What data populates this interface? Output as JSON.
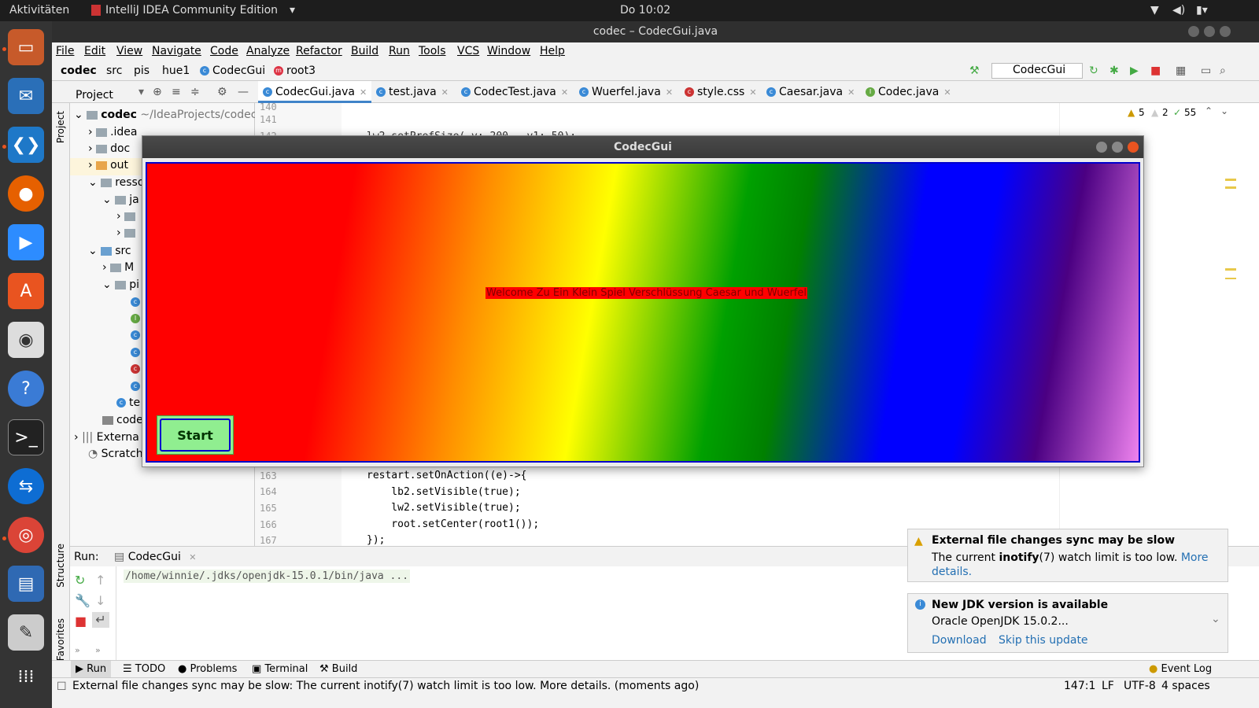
{
  "system": {
    "activities": "Aktivitäten",
    "app_name": "IntelliJ IDEA Community Edition",
    "clock": "Do 10:02"
  },
  "ide": {
    "title": "codec – CodecGui.java",
    "menu": [
      "File",
      "Edit",
      "View",
      "Navigate",
      "Code",
      "Analyze",
      "Refactor",
      "Build",
      "Run",
      "Tools",
      "VCS",
      "Window",
      "Help"
    ],
    "breadcrumbs": [
      "codec",
      "src",
      "pis",
      "hue1",
      "CodecGui",
      "root3"
    ],
    "run_config": "CodecGui",
    "tabs": [
      "CodecGui.java",
      "test.java",
      "CodecTest.java",
      "Wuerfel.java",
      "style.css",
      "Caesar.java",
      "Codec.java"
    ],
    "project_label": "Project",
    "project_tree": [
      {
        "label": "codec",
        "hint": "~/IdeaProjects/codec"
      },
      {
        "label": ".idea"
      },
      {
        "label": "doc"
      },
      {
        "label": "out"
      },
      {
        "label": "resso"
      },
      {
        "label": "ja"
      },
      {
        "label": "src"
      },
      {
        "label": "M"
      },
      {
        "label": "pi"
      },
      {
        "label": "te"
      },
      {
        "label": "code"
      },
      {
        "label": "Externa"
      },
      {
        "label": "Scratch"
      }
    ],
    "inspections": {
      "warnings": "5",
      "weak": "2",
      "ok": "55"
    },
    "line_numbers_top": [
      "140",
      "141",
      "142"
    ],
    "code_top": "lw2.setPrefSize( v: 200,  v1: 50);",
    "line_numbers": [
      "163",
      "164",
      "165",
      "166",
      "167"
    ],
    "code_lines": [
      "restart.setOnAction((e)->{",
      "    lb2.setVisible(true);",
      "    lw2.setVisible(true);",
      "    root.setCenter(root1());",
      "});"
    ],
    "side_labels": {
      "project": "Project",
      "structure": "Structure",
      "favorites": "Favorites"
    }
  },
  "run": {
    "label": "Run:",
    "config": "CodecGui",
    "output": "/home/winnie/.jdks/openjdk-15.0.1/bin/java ..."
  },
  "bottom_tabs": [
    "Run",
    "TODO",
    "Problems",
    "Terminal",
    "Build"
  ],
  "event_log": "Event Log",
  "status": {
    "message": "External file changes sync may be slow: The current inotify(7) watch limit is too low. More details. (moments ago)",
    "position": "147:1",
    "line_sep": "LF",
    "encoding": "UTF-8",
    "indent": "4 spaces"
  },
  "notifications": [
    {
      "title": "External file changes sync may be slow",
      "body_pre": "The current ",
      "body_bold": "inotify",
      "body_post": "(7) watch limit is too low.",
      "link": "More details."
    },
    {
      "title": "New JDK version is available",
      "body": "Oracle OpenJDK 15.0.2...",
      "actions": [
        "Download",
        "Skip this update"
      ]
    }
  ],
  "codecgui": {
    "title": "CodecGui",
    "welcome": "Welcome Zu Ein Klein Spiel Verschlüssung Caesar und Wuerfel",
    "start": "Start"
  }
}
